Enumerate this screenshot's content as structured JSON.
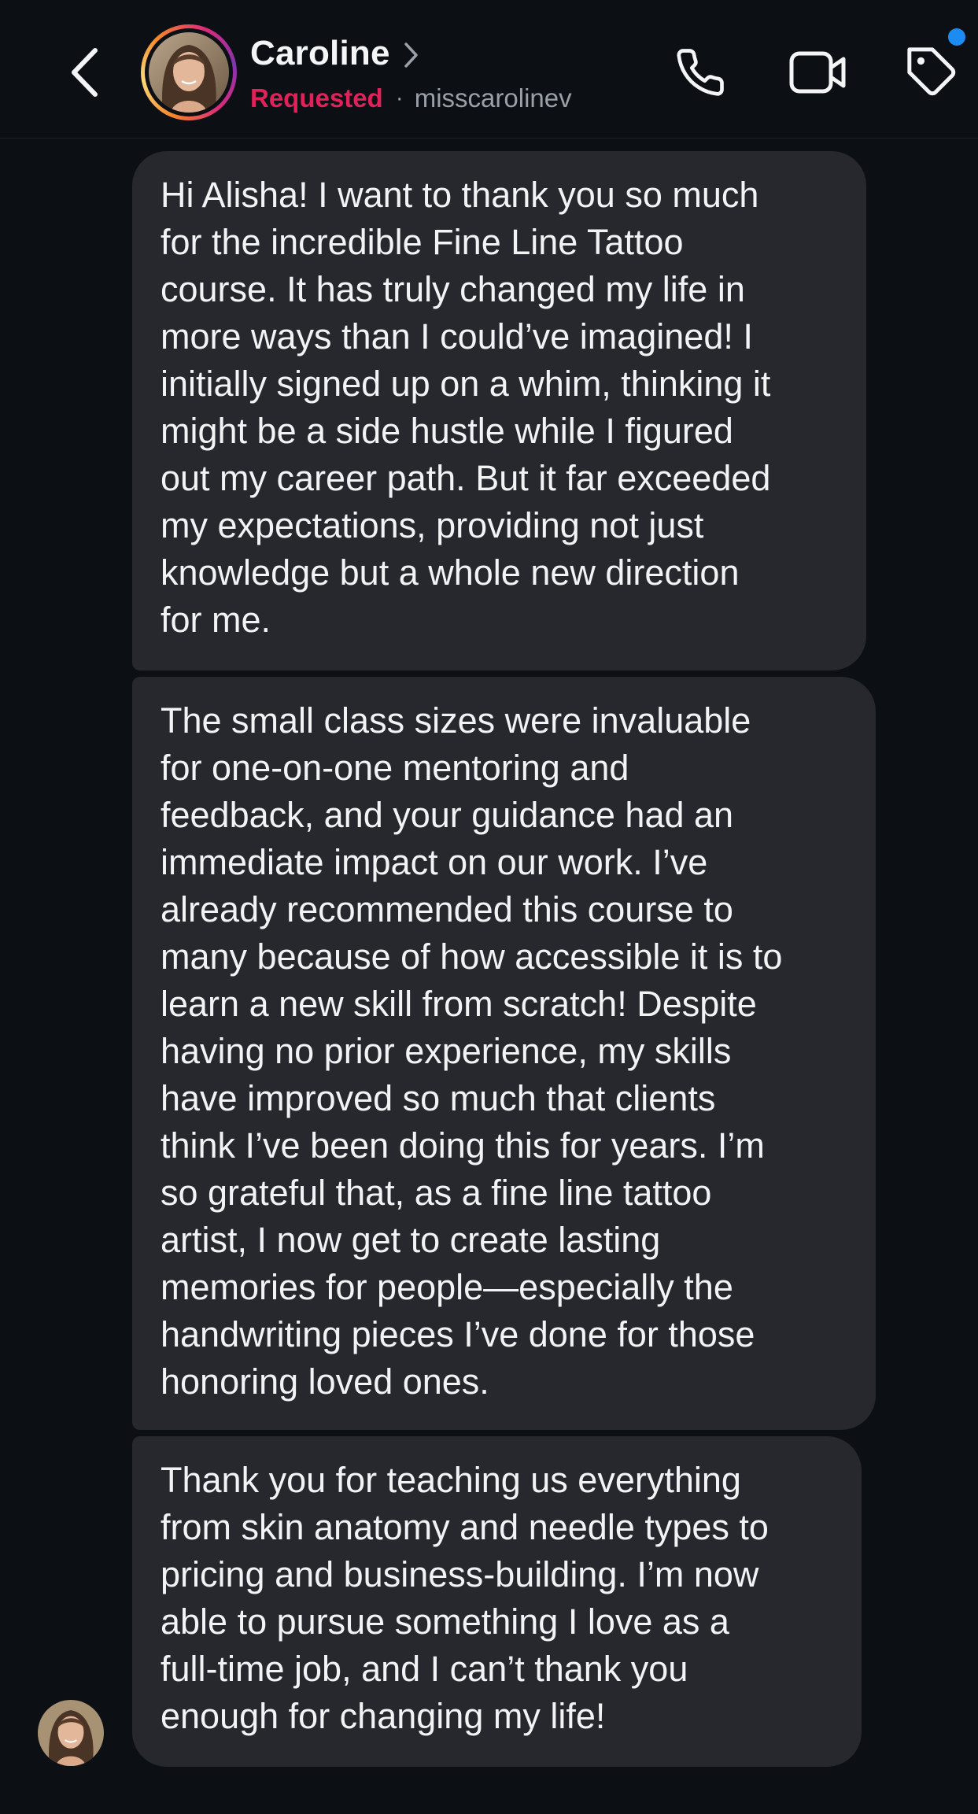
{
  "header": {
    "contact_name": "Caroline",
    "status": "Requested",
    "separator": "·",
    "username": "misscarolinev",
    "icons": {
      "back": "chevron-left-icon",
      "name_chevron": "chevron-right-icon",
      "call": "phone-icon",
      "video": "video-camera-icon",
      "tag": "tag-icon"
    },
    "notification_dot": true
  },
  "colors": {
    "background": "#0c0f14",
    "bubble": "#26282e",
    "requested": "#e0215a",
    "secondary_text": "#9aa0a8",
    "notification_dot": "#1d8cf2"
  },
  "messages": [
    {
      "text": "Hi Alisha! I want to thank you so much\nfor the incredible Fine Line Tattoo\ncourse. It has truly changed my life in\nmore ways than I could’ve imagined! I\ninitially signed up on a whim, thinking it\nmight be a side hustle while I figured\nout my career path. But it far exceeded\nmy expectations, providing not just\nknowledge but a whole new direction\nfor me."
    },
    {
      "text": "The small class sizes were invaluable\nfor one-on-one mentoring and\nfeedback, and your guidance had an\nimmediate impact on our work. I’ve\nalready recommended this course to\nmany because of how accessible it is to\nlearn a new skill from scratch! Despite\nhaving no prior experience, my skills\nhave improved so much that clients\nthink I’ve been doing this for years. I’m\nso grateful that, as a fine line tattoo\nartist, I now get to create lasting\nmemories for people—especially the\nhandwriting pieces I’ve done for those\nhonoring loved ones."
    },
    {
      "text": "Thank you for teaching us everything\nfrom skin anatomy and needle types to\npricing and business-building. I’m now\nable to pursue something I love as a\nfull-time job, and I can’t thank you\nenough for changing my life!"
    }
  ]
}
